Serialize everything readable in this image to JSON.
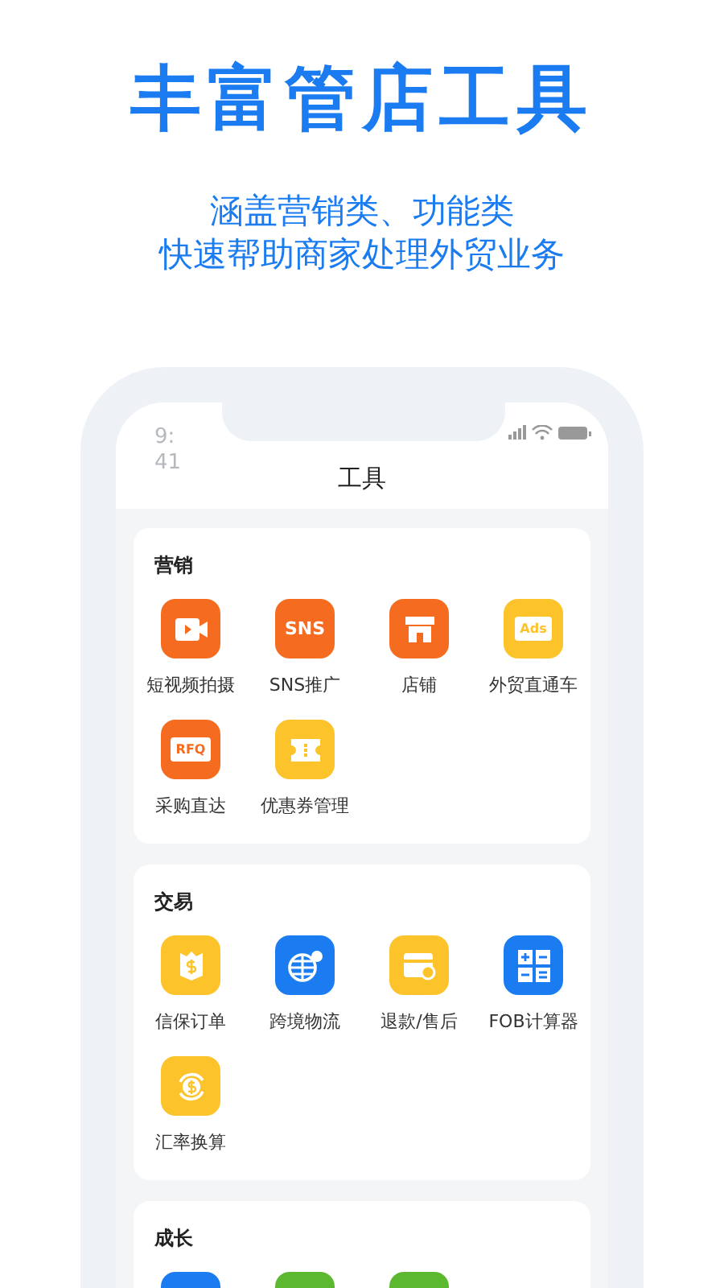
{
  "headline": "丰富管店工具",
  "subtitle": [
    "涵盖营销类、功能类",
    "快速帮助商家处理外贸业务"
  ],
  "status_bar": {
    "time": "9:41"
  },
  "screen_title": "工具",
  "sections": [
    {
      "title": "营销",
      "tools": [
        {
          "label": "短视频拍摄",
          "kind": "video",
          "color": "#f56b1f"
        },
        {
          "label": "SNS推广",
          "kind": "text",
          "badge_text": "SNS",
          "color": "#f56b1f"
        },
        {
          "label": "店铺",
          "kind": "store",
          "color": "#f56b1f"
        },
        {
          "label": "外贸直通车",
          "kind": "tag",
          "badge_text": "Ads",
          "color": "#fcc32b"
        },
        {
          "label": "采购直达",
          "kind": "tag",
          "badge_text": "RFQ",
          "color": "#f56b1f"
        },
        {
          "label": "优惠券管理",
          "kind": "coupon",
          "color": "#fcc32b"
        }
      ]
    },
    {
      "title": "交易",
      "tools": [
        {
          "label": "信保订单",
          "kind": "shield",
          "color": "#fcc32b"
        },
        {
          "label": "跨境物流",
          "kind": "globe",
          "color": "#1a7cf0"
        },
        {
          "label": "退款/售后",
          "kind": "wallet",
          "color": "#fcc32b"
        },
        {
          "label": "FOB计算器",
          "kind": "calculator",
          "color": "#1a7cf0"
        },
        {
          "label": "汇率换算",
          "kind": "exchange",
          "color": "#fcc32b"
        }
      ]
    },
    {
      "title": "成长",
      "tools": [
        {
          "kind": "blank",
          "color": "#1a7cf0"
        },
        {
          "kind": "blank",
          "color": "#5cb82e"
        },
        {
          "kind": "blank",
          "color": "#5cb82e"
        }
      ]
    }
  ]
}
